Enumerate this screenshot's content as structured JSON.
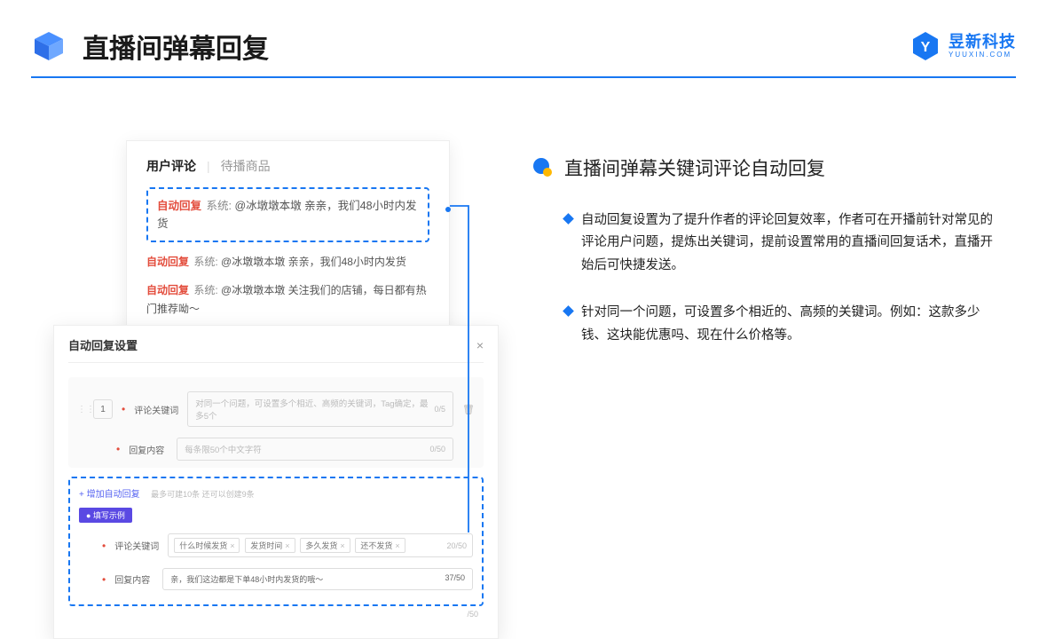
{
  "header": {
    "title": "直播间弹幕回复",
    "brand_zh": "昱新科技",
    "brand_en": "YUUXIN.COM"
  },
  "comments_panel": {
    "tab_active": "用户评论",
    "tab_inactive": "待播商品",
    "highlighted": {
      "tag": "自动回复",
      "sys": "系统:",
      "text": "@冰墩墩本墩 亲亲，我们48小时内发货"
    },
    "line2": {
      "tag": "自动回复",
      "sys": "系统:",
      "text": "@冰墩墩本墩 亲亲，我们48小时内发货"
    },
    "line3": {
      "tag": "自动回复",
      "sys": "系统:",
      "text": "@冰墩墩本墩 关注我们的店铺，每日都有热门推荐呦～"
    }
  },
  "settings_panel": {
    "title": "自动回复设置",
    "index": "1",
    "kw_label": "评论关键词",
    "kw_placeholder": "对同一个问题，可设置多个相近、高频的关键词，Tag确定，最多5个",
    "kw_count": "0/5",
    "reply_label": "回复内容",
    "reply_placeholder": "每条限50个中文字符",
    "reply_count": "0/50",
    "add_link": "+ 增加自动回复",
    "add_hint": "最多可建10条 还可以创建9条",
    "example_badge": "● 填写示例",
    "ex_kw_label": "评论关键词",
    "ex_chips": [
      "什么时候发货",
      "发货时间",
      "多久发货",
      "还不发货"
    ],
    "ex_kw_count": "20/50",
    "ex_reply_label": "回复内容",
    "ex_reply_text": "亲，我们这边都是下单48小时内发货的哦～",
    "ex_reply_count": "37/50",
    "outer_count": "/50"
  },
  "right": {
    "title": "直播间弹幕关键词评论自动回复",
    "bullet1": "自动回复设置为了提升作者的评论回复效率，作者可在开播前针对常见的评论用户问题，提炼出关键词，提前设置常用的直播间回复话术，直播开始后可快捷发送。",
    "bullet2": "针对同一个问题，可设置多个相近的、高频的关键词。例如：这款多少钱、这块能优惠吗、现在什么价格等。"
  }
}
